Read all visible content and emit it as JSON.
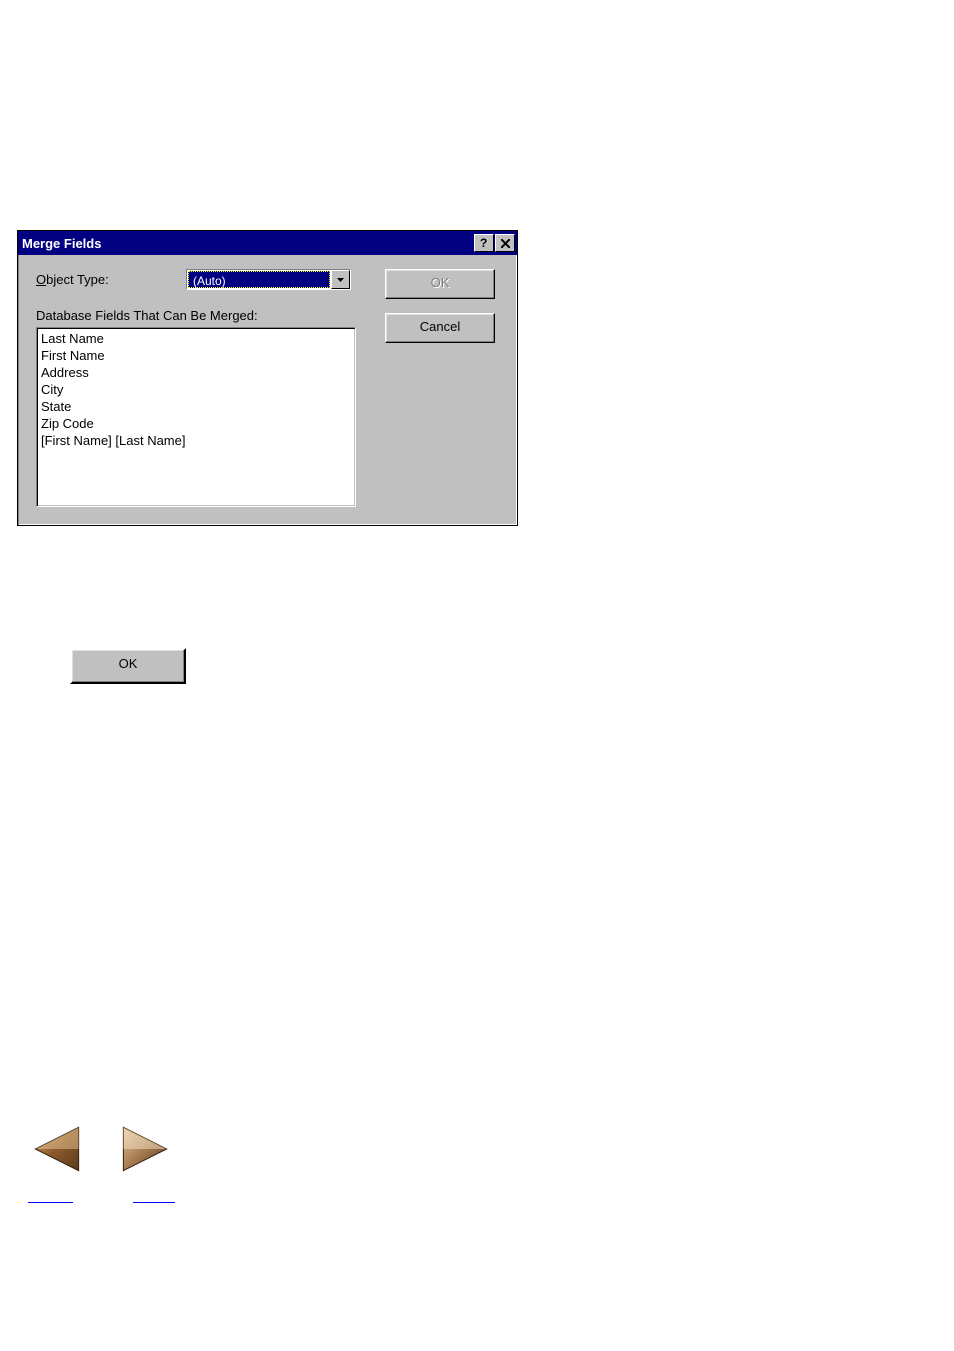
{
  "dialog": {
    "title": "Merge Fields",
    "object_type_label_prefix": "O",
    "object_type_label_rest": "bject Type:",
    "object_type_value": "(Auto)",
    "fields_label_prefix": "Database ",
    "fields_label_underline": "F",
    "fields_label_rest": "ields That Can Be Merged:",
    "fields": [
      "Last Name",
      "First Name",
      "Address",
      "City",
      "State",
      "Zip Code",
      "[First Name] [Last Name]"
    ],
    "ok_label": "OK",
    "cancel_label": "Cancel"
  },
  "standalone": {
    "ok_label": "OK"
  }
}
